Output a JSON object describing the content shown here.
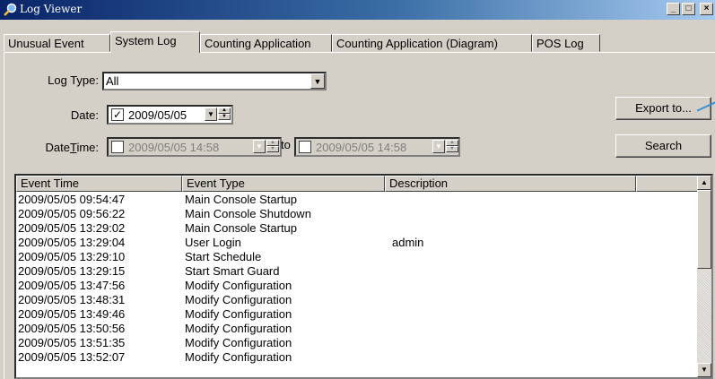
{
  "window": {
    "title": "Log Viewer",
    "minimize": "_",
    "maximize": "□",
    "close": "×"
  },
  "tabs": [
    {
      "label": "Unusual Event"
    },
    {
      "label": "System Log"
    },
    {
      "label": "Counting Application"
    },
    {
      "label": "Counting Application (Diagram)"
    },
    {
      "label": "POS Log"
    }
  ],
  "active_tab": "System Log",
  "form": {
    "log_type_label": "Log Type:",
    "log_type_value": "All",
    "date_label": "Date:",
    "date_value": "2009/05/05",
    "date_checked": true,
    "datetime_label_pre": "Date",
    "datetime_label_u": "T",
    "datetime_label_post": "ime:",
    "datetime_from": "2009/05/05 14:58",
    "datetime_to_label": "to",
    "datetime_to": "2009/05/05 14:58"
  },
  "buttons": {
    "export": "Export to...",
    "search": "Search"
  },
  "table": {
    "columns": [
      "Event Time",
      "Event Type",
      "Description"
    ],
    "rows": [
      [
        "2009/05/05 09:54:47",
        "Main Console Startup",
        ""
      ],
      [
        "2009/05/05 09:56:22",
        "Main Console Shutdown",
        ""
      ],
      [
        "2009/05/05 13:29:02",
        "Main Console Startup",
        ""
      ],
      [
        "2009/05/05 13:29:04",
        "User Login",
        "admin"
      ],
      [
        "2009/05/05 13:29:10",
        "Start Schedule",
        ""
      ],
      [
        "2009/05/05 13:29:15",
        "Start Smart Guard",
        ""
      ],
      [
        "2009/05/05 13:47:56",
        "Modify Configuration",
        ""
      ],
      [
        "2009/05/05 13:48:31",
        "Modify Configuration",
        ""
      ],
      [
        "2009/05/05 13:49:46",
        "Modify Configuration",
        ""
      ],
      [
        "2009/05/05 13:50:56",
        "Modify Configuration",
        ""
      ],
      [
        "2009/05/05 13:51:35",
        "Modify Configuration",
        ""
      ],
      [
        "2009/05/05 13:52:07",
        "Modify Configuration",
        ""
      ]
    ]
  },
  "icons": {
    "app": "magnifier-icon",
    "dropdown": "chevron-down-icon",
    "scroll_up": "arrow-up-icon",
    "scroll_down": "arrow-down-icon"
  }
}
